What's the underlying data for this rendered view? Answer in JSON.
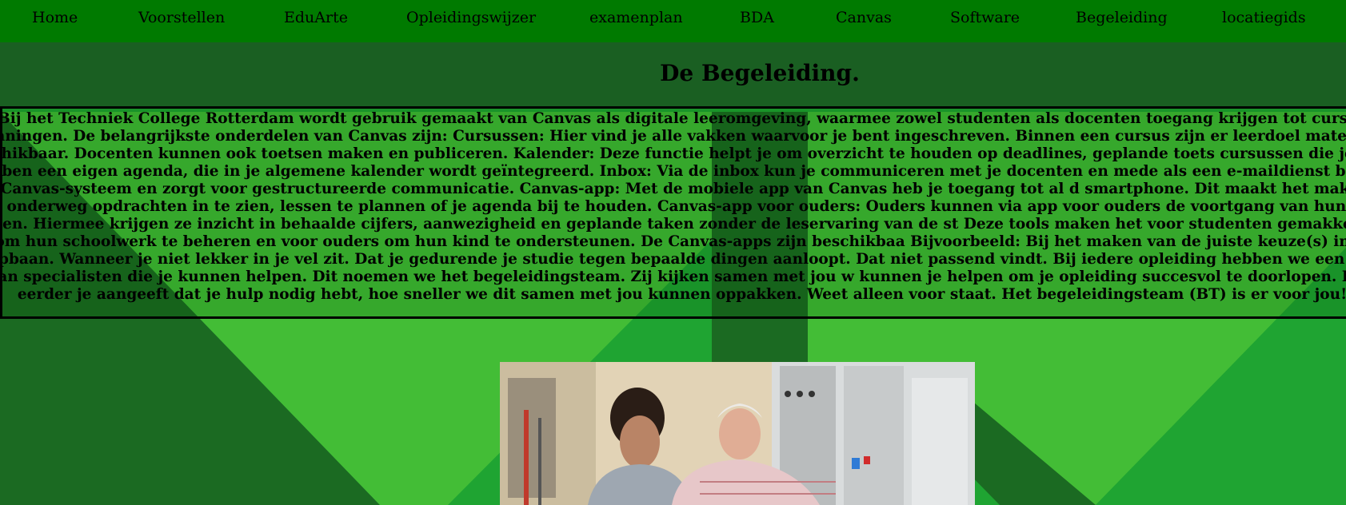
{
  "nav": {
    "items": [
      {
        "label": "Home"
      },
      {
        "label": "Voorstellen"
      },
      {
        "label": "EduArte"
      },
      {
        "label": "Opleidingswijzer"
      },
      {
        "label": "examenplan"
      },
      {
        "label": "BDA"
      },
      {
        "label": "Canvas"
      },
      {
        "label": "Software"
      },
      {
        "label": "Begeleiding"
      },
      {
        "label": "locatiegids"
      }
    ]
  },
  "page": {
    "title": "De Begeleiding.",
    "body": "Bij het Techniek College Rotterdam wordt gebruik gemaakt van Canvas als digitale leeromgeving, waarmee zowel studenten als docenten toegang krijgen tot cursus planningen. De belangrijkste onderdelen van Canvas zijn: Cursussen: Hier vind je alle vakken waarvoor je bent ingeschreven. Binnen een cursus zijn er leerdoel materialen beschikbaar. Docenten kunnen ook toetsen maken en publiceren. Kalender: Deze functie helpt je om overzicht te houden op deadlines, geplande toets cursussen die je volgt hebben een eigen agenda, die in je algemene kalender wordt geïntegreerd. Inbox: Via de inbox kun je communiceren met je docenten en mede als een e-maildienst binnen het Canvas-systeem en zorgt voor gestructureerde communicatie. Canvas-app: Met de mobiele app van Canvas heb je toegang tot al d smartphone. Dit maakt het makkelijk om onderweg opdrachten in te zien, lessen te plannen of je agenda bij te houden. Canvas-app voor ouders: Ouders kunnen via app voor ouders de voortgang van hun kind volgen. Hiermee krijgen ze inzicht in behaalde cijfers, aanwezigheid en geplande taken zonder de leservaring van de st Deze tools maken het voor studenten gemakkelijker om hun schoolwerk te beheren en voor ouders om hun kind te ondersteunen. De Canvas-apps zijn beschikbaa Bijvoorbeeld: Bij het maken van de juiste keuze(s) in je loopbaan. Wanneer je niet lekker in je vel zit. Dat je gedurende je studie tegen bepaalde dingen aanloopt. Dat niet passend vindt. Bij iedere opleiding hebben we een team van specialisten die je kunnen helpen. Dit noemen we het begeleidingsteam. Zij kijken samen met jou w kunnen je helpen om je opleiding succesvol te doorlopen. Hoe eerder je aangeeft dat je hulp nodig hebt, hoe sneller we dit samen met jou kunnen oppakken. Weet alleen voor staat. Het begeleidingsteam (BT) is er voor jou!"
  },
  "colors": {
    "nav_bg": "#007a00",
    "header_band": "#1a5f22",
    "bg_dark": "#1b6a22",
    "bg_mid": "#1fa432",
    "bg_light": "#43bd36"
  }
}
